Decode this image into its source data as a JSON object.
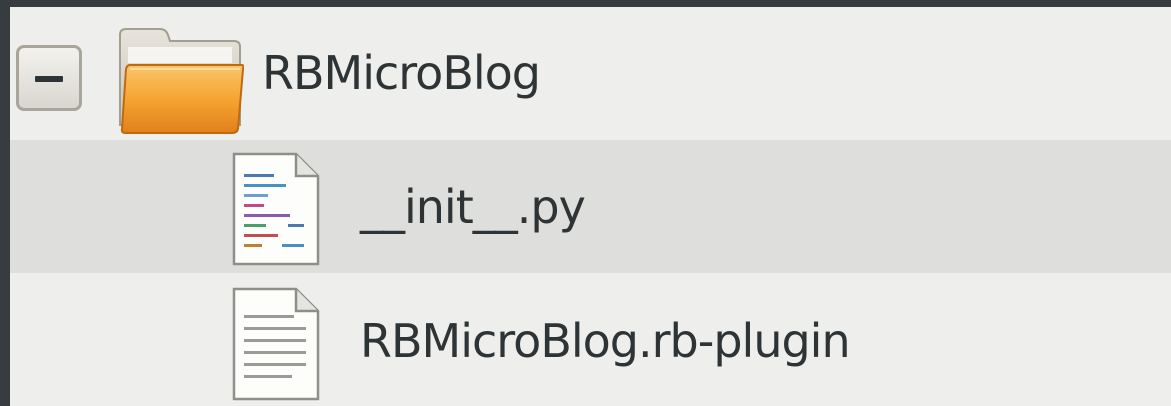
{
  "tree": {
    "folder": {
      "name": "RBMicroBlog",
      "expander_symbol": "minus",
      "icon": "folder-icon"
    },
    "files": [
      {
        "name": "__init__.py",
        "icon": "python-file-icon",
        "selected": true
      },
      {
        "name": "RBMicroBlog.rb-plugin",
        "icon": "text-file-icon",
        "selected": false
      }
    ]
  },
  "colors": {
    "background": "#eeeeec",
    "selected_row": "#dededc",
    "border_dark": "#363c40",
    "text": "#2e3436",
    "folder_orange": "#f29a1e"
  }
}
